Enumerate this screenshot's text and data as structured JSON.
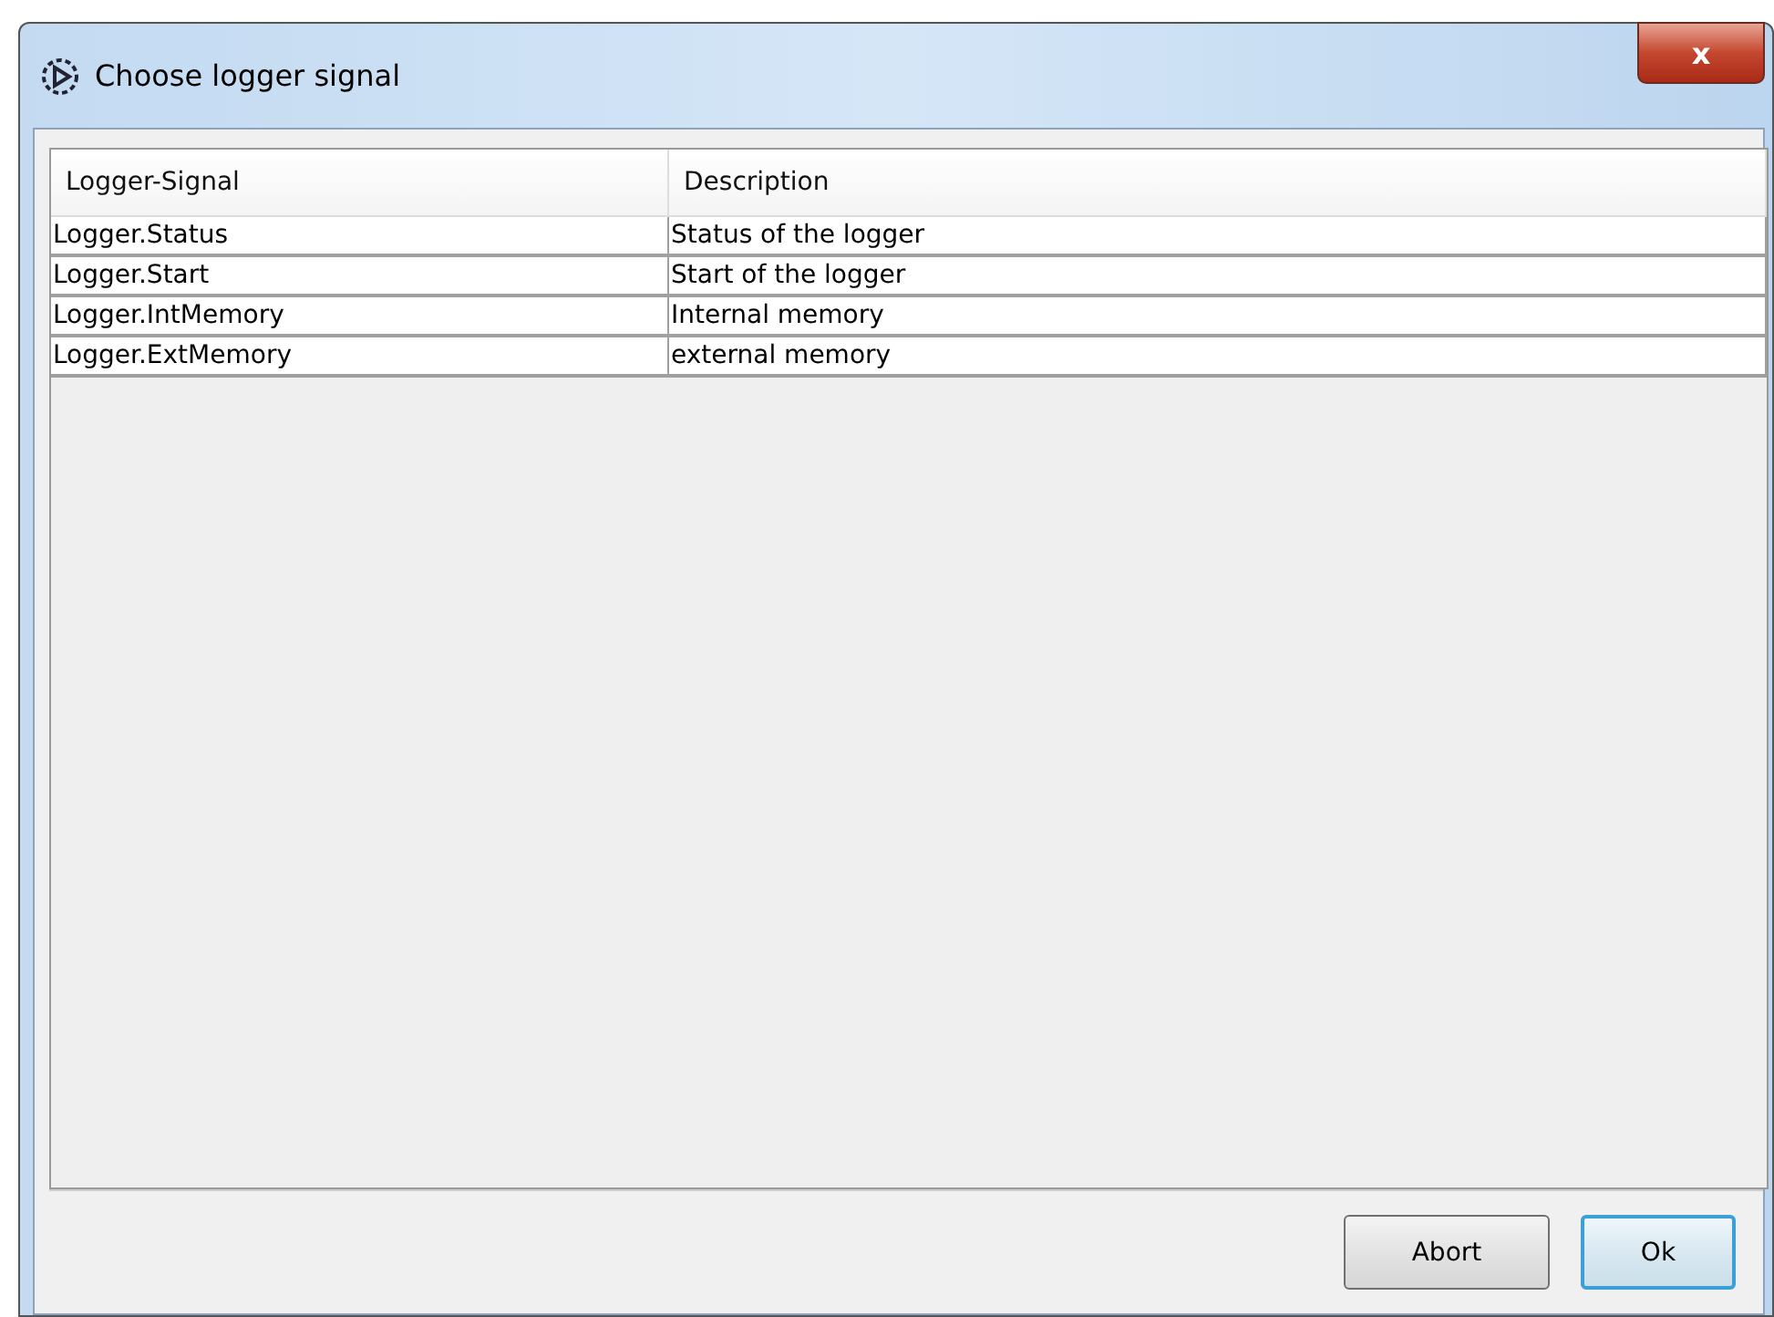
{
  "window": {
    "title": "Choose logger signal",
    "close": "x"
  },
  "table": {
    "columns": [
      "Logger-Signal",
      "Description"
    ],
    "rows": [
      [
        "Logger.Status",
        "Status of the logger"
      ],
      [
        "Logger.Start",
        "Start of the logger"
      ],
      [
        "Logger.IntMemory",
        "Internal memory"
      ],
      [
        "Logger.ExtMemory",
        "external memory"
      ]
    ]
  },
  "buttons": [
    {
      "label": "Abort",
      "default": false
    },
    {
      "label": "Ok",
      "default": true
    }
  ]
}
